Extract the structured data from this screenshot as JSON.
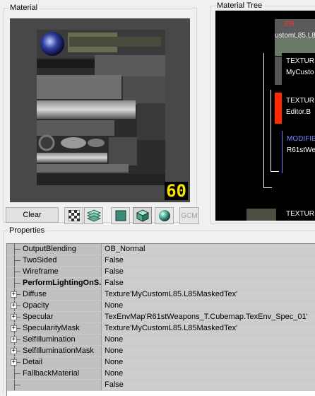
{
  "material_panel": {
    "title": "Material",
    "lod_badge": "60"
  },
  "material_tree": {
    "title": "Material Tree",
    "nodes": [
      {
        "type_label": "ER",
        "name": "ustomL85.L8"
      },
      {
        "type_label": "TEXTUR",
        "name": "MyCusto"
      },
      {
        "type_label": "TEXTUR",
        "name": "Editor.B"
      },
      {
        "type_label": "MODIFIE",
        "name": "R61stWe"
      },
      {
        "type_label": "TEXTUR",
        "name": ""
      }
    ]
  },
  "toolbar": {
    "clear_label": "Clear",
    "gcm_label": "GCM"
  },
  "properties": {
    "title": "Properties",
    "rows": [
      {
        "name": "OutputBlending",
        "value": "OB_Normal",
        "expandable": false,
        "bold": false
      },
      {
        "name": "TwoSided",
        "value": "False",
        "expandable": false,
        "bold": false
      },
      {
        "name": "Wireframe",
        "value": "False",
        "expandable": false,
        "bold": false
      },
      {
        "name": "PerformLightingOnS...",
        "value": "False",
        "expandable": false,
        "bold": true
      },
      {
        "name": "Diffuse",
        "value": "Texture'MyCustomL85.L85MaskedTex'",
        "expandable": true,
        "bold": false
      },
      {
        "name": "Opacity",
        "value": "None",
        "expandable": true,
        "bold": false
      },
      {
        "name": "Specular",
        "value": "TexEnvMap'R61stWeapons_T.Cubemap.TexEnv_Spec_01'",
        "expandable": true,
        "bold": false
      },
      {
        "name": "SpecularityMask",
        "value": "Texture'MyCustomL85.L85MaskedTex'",
        "expandable": true,
        "bold": false
      },
      {
        "name": "SelfIllumination",
        "value": "None",
        "expandable": true,
        "bold": false
      },
      {
        "name": "SelfIlluminationMask",
        "value": "None",
        "expandable": true,
        "bold": false
      },
      {
        "name": "Detail",
        "value": "None",
        "expandable": true,
        "bold": false
      },
      {
        "name": "FallbackMaterial",
        "value": "None",
        "expandable": false,
        "bold": false
      },
      {
        "name": "",
        "value": "False",
        "expandable": false,
        "bold": false
      }
    ]
  }
}
